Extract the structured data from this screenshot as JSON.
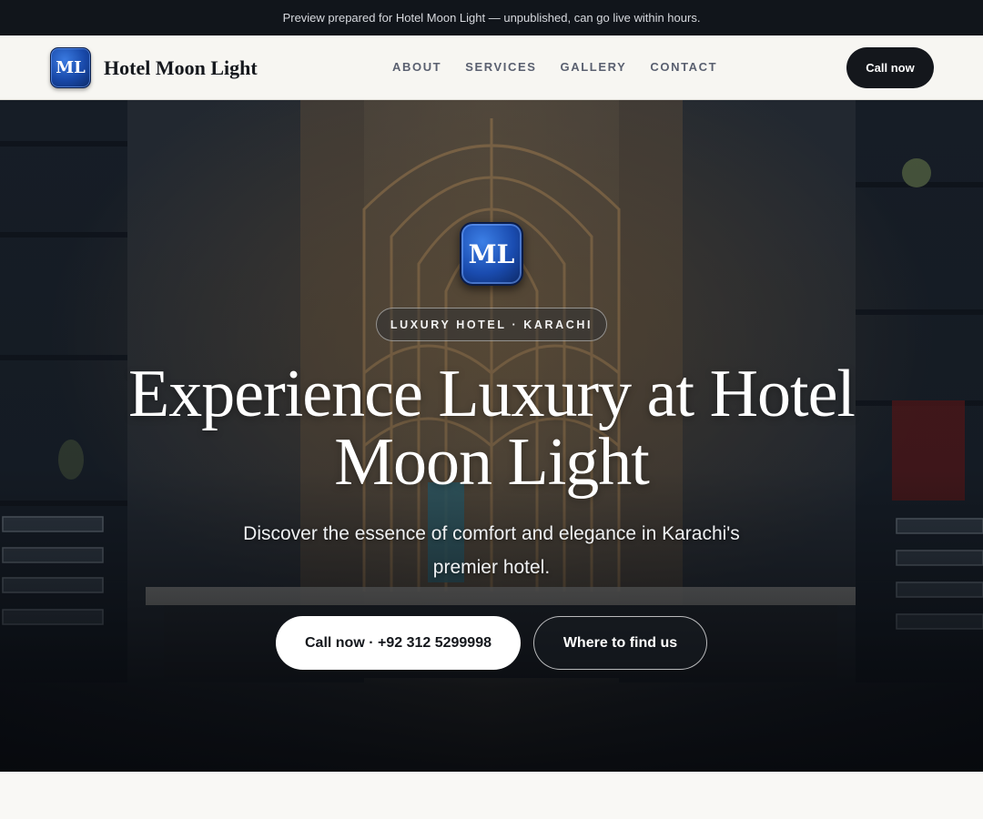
{
  "preview_bar": {
    "text": "Preview prepared for Hotel Moon Light — unpublished, can go live within hours."
  },
  "header": {
    "logo_text": "ML",
    "brand_name": "Hotel Moon Light",
    "nav": [
      "ABOUT",
      "SERVICES",
      "GALLERY",
      "CONTACT"
    ],
    "call_label": "Call now"
  },
  "hero": {
    "logo_text": "ML",
    "tagline": "LUXURY HOTEL · KARACHI",
    "headline": "Experience Luxury at Hotel Moon Light",
    "subtitle": "Discover the essence of comfort and elegance in Karachi's premier hotel.",
    "primary_cta": "Call now · +92 312 5299998",
    "secondary_cta": "Where to find us"
  },
  "colors": {
    "dark": "#14171c",
    "logo_blue": "#1848a8",
    "background": "#f7f6f2"
  }
}
